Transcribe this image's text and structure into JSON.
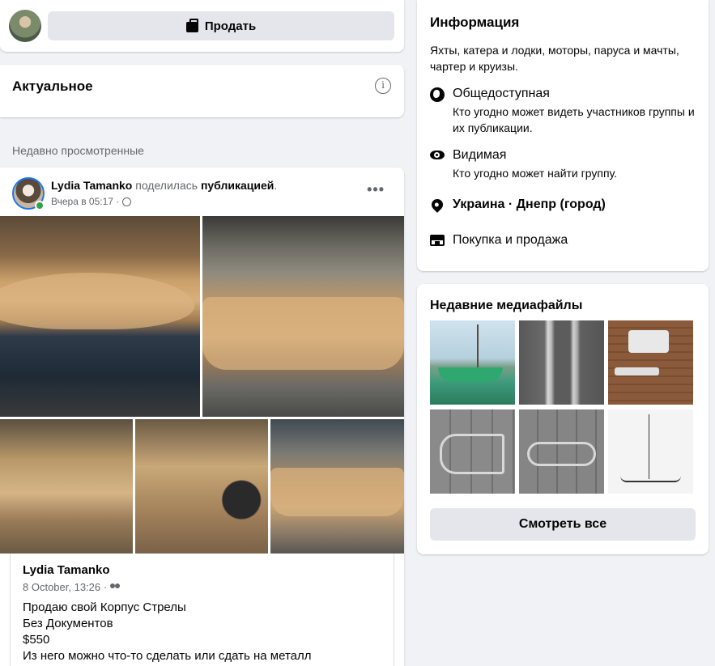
{
  "composer": {
    "sell_label": "Продать",
    "sell_icon": "shopping-bag-icon"
  },
  "highlights": {
    "title": "Актуальное",
    "info_icon": "info-icon",
    "info_glyph": "i"
  },
  "recent_label": "Недавно просмотренные",
  "post": {
    "author": "Lydia Tamanko",
    "action": " поделилась ",
    "object": "публикацией",
    "object_suffix": ".",
    "time": "Вчера в 05:17 ·",
    "privacy_icon": "globe-icon",
    "more_glyph": "•••",
    "photos": [
      {
        "name": "boat-hull-photo-1"
      },
      {
        "name": "boat-hull-photo-2"
      },
      {
        "name": "boat-interior-photo-3"
      },
      {
        "name": "boat-interior-photo-4"
      },
      {
        "name": "boat-hull-photo-5"
      }
    ],
    "shared": {
      "author": "Lydia Tamanko",
      "date": "8 October, 13:26 ·",
      "audience_icon": "group-icon",
      "lines": [
        "Продаю свой Корпус Стрелы",
        "Без Документов",
        "$550",
        "Из него можно что-то сделать или сдать на металл"
      ]
    }
  },
  "info": {
    "title": "Информация",
    "description": "Яхты, катера и лодки, моторы, паруса и мачты, чартер и круизы.",
    "privacy_title": "Общедоступная",
    "privacy_desc": "Кто угодно может видеть участников группы и их публикации.",
    "visibility_title": "Видимая",
    "visibility_desc": "Кто угодно может найти группу.",
    "location": "Украина · Днепр (город)",
    "category": "Покупка и продажа"
  },
  "media": {
    "title": "Недавние медиафайлы",
    "see_all": "Смотреть все"
  }
}
